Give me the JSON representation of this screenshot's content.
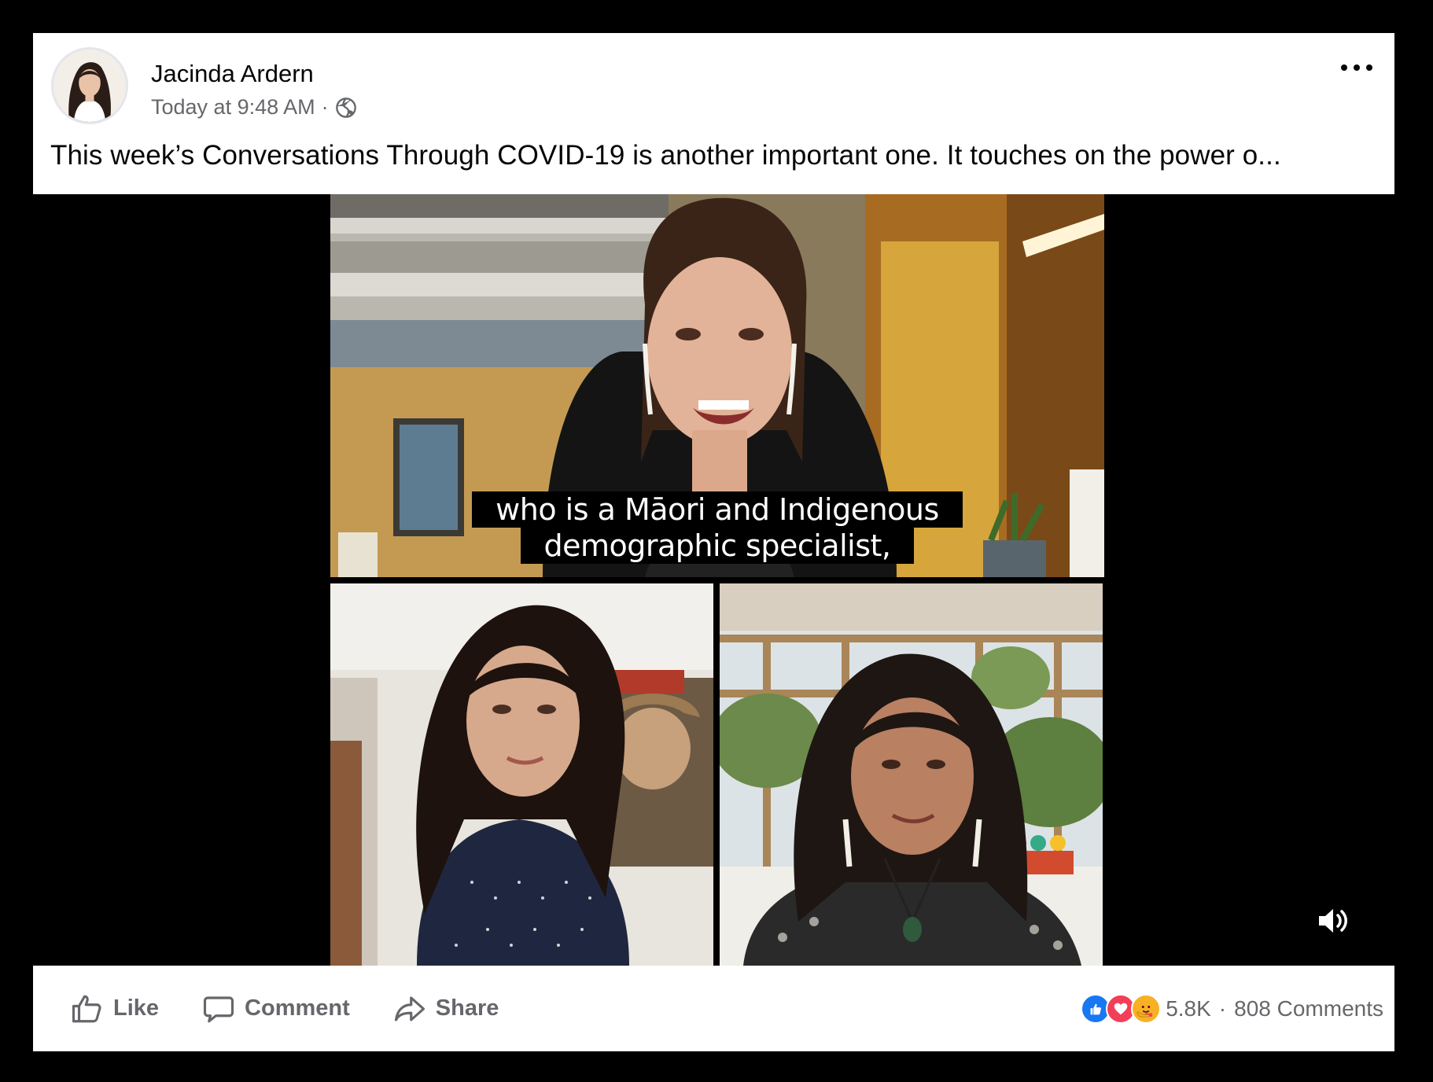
{
  "post": {
    "author": "Jacinda Ardern",
    "timestamp": "Today at 9:48 AM",
    "separator": "·",
    "privacy_icon": "globe-icon",
    "more_icon": "more-options-icon",
    "text": "This week’s Conversations Through COVID-19 is another important one. It touches on the power o..."
  },
  "video": {
    "caption_line1": "who is a Māori and Indigenous",
    "caption_line2": "demographic specialist,",
    "volume_icon": "volume-icon"
  },
  "actions": {
    "like_label": "Like",
    "comment_label": "Comment",
    "share_label": "Share"
  },
  "engagement": {
    "reaction_icons": [
      "like-reaction-icon",
      "love-reaction-icon",
      "care-reaction-icon"
    ],
    "reaction_count": "5.8K",
    "separator": "·",
    "comments": "808 Comments"
  },
  "colors": {
    "brand_blue": "#1877f2",
    "love_red": "#f33e58",
    "care_yellow": "#f7b125",
    "text_primary": "#050505",
    "text_secondary": "#65676b"
  }
}
